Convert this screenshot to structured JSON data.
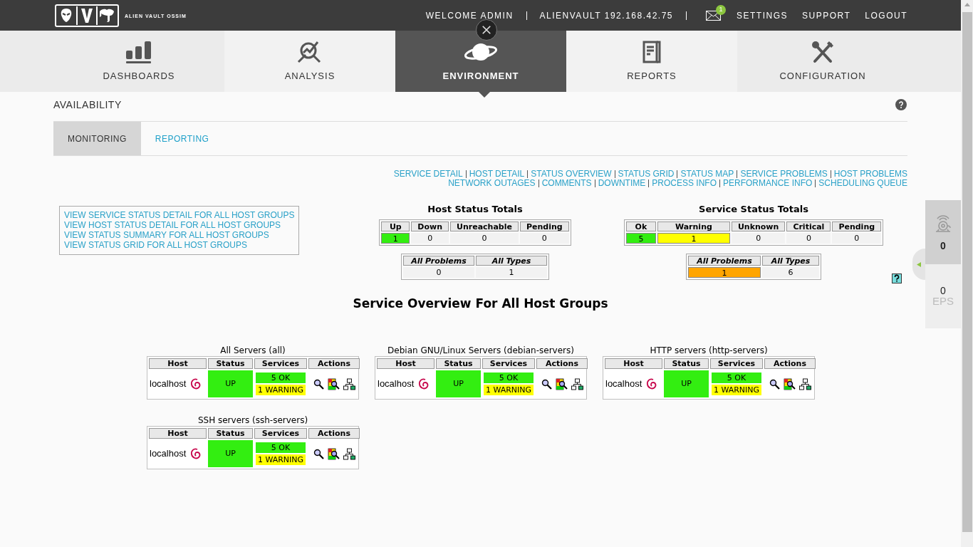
{
  "header": {
    "logo_text": "ALIEN VAULT OSSIM",
    "welcome": "WELCOME ADMIN",
    "host": "ALIENVAULT 192.168.42.75",
    "messages_badge": "1",
    "links": [
      "SETTINGS",
      "SUPPORT",
      "LOGOUT"
    ]
  },
  "nav_tabs": [
    {
      "label": "DASHBOARDS",
      "selected": false
    },
    {
      "label": "ANALYSIS",
      "selected": false
    },
    {
      "label": "ENVIRONMENT",
      "selected": true
    },
    {
      "label": "REPORTS",
      "selected": false
    },
    {
      "label": "CONFIGURATION",
      "selected": false
    }
  ],
  "page": {
    "title": "AVAILABILITY",
    "subtabs": [
      {
        "label": "MONITORING",
        "selected": true
      },
      {
        "label": "REPORTING",
        "selected": false
      }
    ]
  },
  "nav_links": [
    [
      "SERVICE DETAIL",
      "HOST DETAIL",
      "STATUS OVERVIEW",
      "STATUS GRID",
      "STATUS MAP",
      "SERVICE PROBLEMS",
      "HOST PROBLEMS"
    ],
    [
      "NETWORK OUTAGES",
      "COMMENTS",
      "DOWNTIME",
      "PROCESS INFO",
      "PERFORMANCE INFO",
      "SCHEDULING QUEUE"
    ]
  ],
  "summary_links": [
    "VIEW SERVICE STATUS DETAIL FOR ALL HOST GROUPS",
    "VIEW HOST STATUS DETAIL FOR ALL HOST GROUPS",
    "VIEW STATUS SUMMARY FOR ALL HOST GROUPS",
    "VIEW STATUS GRID FOR ALL HOST GROUPS"
  ],
  "host_status_totals": {
    "title": "Host Status Totals",
    "columns": [
      {
        "label": "Up",
        "value": "1",
        "color": "#33ee11"
      },
      {
        "label": "Down",
        "value": "0"
      },
      {
        "label": "Unreachable",
        "value": "0"
      },
      {
        "label": "Pending",
        "value": "0"
      }
    ],
    "problems": [
      {
        "label": "All Problems",
        "value": "0"
      },
      {
        "label": "All Types",
        "value": "1"
      }
    ]
  },
  "service_status_totals": {
    "title": "Service Status Totals",
    "columns": [
      {
        "label": "Ok",
        "value": "5",
        "color": "#33ee11"
      },
      {
        "label": "Warning",
        "value": "1",
        "color": "#ffff00"
      },
      {
        "label": "Unknown",
        "value": "0"
      },
      {
        "label": "Critical",
        "value": "0"
      },
      {
        "label": "Pending",
        "value": "0"
      }
    ],
    "problems": [
      {
        "label": "All Problems",
        "value": "1",
        "color": "#ffa500"
      },
      {
        "label": "All Types",
        "value": "6"
      }
    ]
  },
  "overview_title": "Service Overview For All Host Groups",
  "groups": [
    {
      "title": "All Servers (all)",
      "columns": [
        "Host",
        "Status",
        "Services",
        "Actions"
      ],
      "host": "localhost",
      "status": {
        "text": "UP",
        "color": "#33ee11"
      },
      "services": [
        {
          "text": "5 OK",
          "color": "#33ee11"
        },
        {
          "text": "1 WARNING",
          "color": "#ffff00"
        }
      ]
    },
    {
      "title": "Debian GNU/Linux Servers (debian-servers)",
      "columns": [
        "Host",
        "Status",
        "Services",
        "Actions"
      ],
      "host": "localhost",
      "status": {
        "text": "UP",
        "color": "#33ee11"
      },
      "services": [
        {
          "text": "5 OK",
          "color": "#33ee11"
        },
        {
          "text": "1 WARNING",
          "color": "#ffff00"
        }
      ]
    },
    {
      "title": "HTTP servers (http-servers)",
      "columns": [
        "Host",
        "Status",
        "Services",
        "Actions"
      ],
      "host": "localhost",
      "status": {
        "text": "UP",
        "color": "#33ee11"
      },
      "services": [
        {
          "text": "5 OK",
          "color": "#33ee11"
        },
        {
          "text": "1 WARNING",
          "color": "#ffff00"
        }
      ]
    },
    {
      "title": "SSH servers (ssh-servers)",
      "columns": [
        "Host",
        "Status",
        "Services",
        "Actions"
      ],
      "host": "localhost",
      "status": {
        "text": "UP",
        "color": "#33ee11"
      },
      "services": [
        {
          "text": "5 OK",
          "color": "#33ee11"
        },
        {
          "text": "1 WARNING",
          "color": "#ffff00"
        }
      ]
    }
  ],
  "side_panel": {
    "alarms": "0",
    "eps_value": "0",
    "eps_label": "EPS"
  }
}
